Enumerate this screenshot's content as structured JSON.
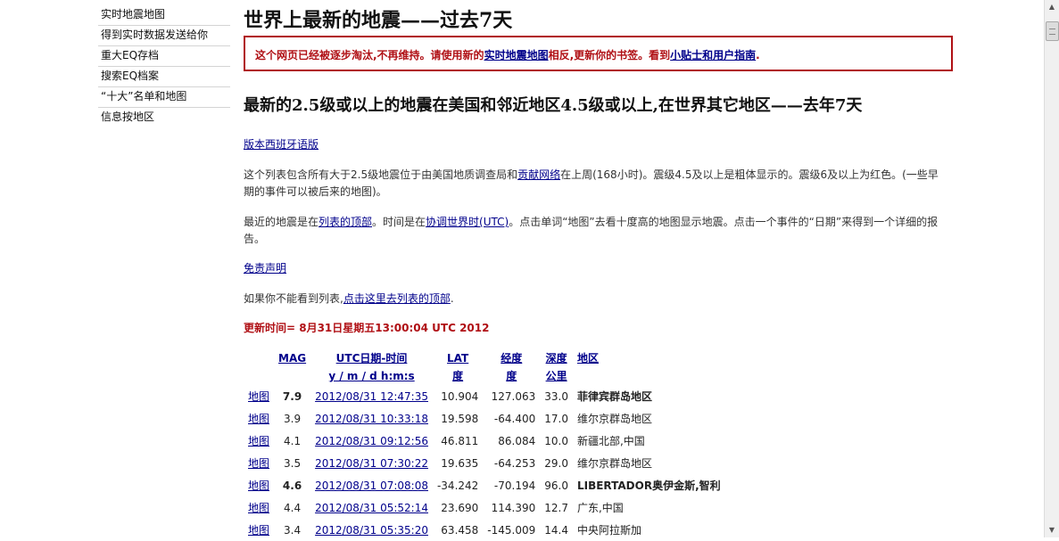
{
  "sidebar": {
    "items": [
      "实时地震地图",
      "得到实时数据发送给你",
      "重大EQ存档",
      "搜索EQ档案",
      "“十大”名单和地图",
      "信息按地区"
    ]
  },
  "header": {
    "title": "世界上最新的地震——过去7天"
  },
  "notice": {
    "text_1": "这个网页已经被逐步淘汰,不再维持。请使用新的",
    "link_1": "实时地震地图",
    "text_2": "相反,更新你的书签。看到",
    "link_2": "小贴士和用户指南",
    "text_3": "."
  },
  "subtitle": "最新的2.5级或以上的地震在美国和邻近地区4.5级或以上,在世界其它地区——去年7天",
  "spanish_link": "版本西班牙语版",
  "description": {
    "text_1": "这个列表包含所有大于2.5级地震位于由美国地质调查局和",
    "link": "贡献网络",
    "text_2": "在上周(168小时)。震级4.5及以上是粗体显示的。震级6及以上为红色。(一些早期的事件可以被后来的地图)。"
  },
  "recent": {
    "text_1": "最近的地震是在",
    "link_1": "列表的顶部",
    "text_2": "。时间是在",
    "link_2": "协调世界时(UTC)",
    "text_3": "。点击单词“地图”去看十度高的地图显示地震。点击一个事件的“日期”来得到一个详细的报告。"
  },
  "disclaimer_link": "免责声明",
  "cannot_see": {
    "text": "如果你不能看到列表,",
    "link": "点击这里去列表的顶部",
    "text_end": "."
  },
  "updated": "更新时间= 8月31日星期五13:00:04 UTC 2012",
  "table": {
    "headers": {
      "mag": "MAG",
      "date_1": "UTC日期-时间",
      "date_2": "y / m / d h:m:s",
      "lat_1": "LAT",
      "lat_2": "度",
      "lon_1": "经度",
      "lon_2": "度",
      "depth_1": "深度",
      "depth_2": "公里",
      "region": "地区"
    },
    "rows": [
      {
        "map": "地图",
        "mag": "7.9",
        "datetime": "2012/08/31 12:47:35",
        "lat": "10.904",
        "lon": "127.063",
        "depth": "33.0",
        "region": "菲律宾群岛地区",
        "style": "red"
      },
      {
        "map": "地图",
        "mag": "3.9",
        "datetime": "2012/08/31 10:33:18",
        "lat": "19.598",
        "lon": "-64.400",
        "depth": "17.0",
        "region": "维尔京群岛地区",
        "style": "normal"
      },
      {
        "map": "地图",
        "mag": "4.1",
        "datetime": "2012/08/31 09:12:56",
        "lat": "46.811",
        "lon": "86.084",
        "depth": "10.0",
        "region": "新疆北部,中国",
        "style": "normal"
      },
      {
        "map": "地图",
        "mag": "3.5",
        "datetime": "2012/08/31 07:30:22",
        "lat": "19.635",
        "lon": "-64.253",
        "depth": "29.0",
        "region": "维尔京群岛地区",
        "style": "normal"
      },
      {
        "map": "地图",
        "mag": "4.6",
        "datetime": "2012/08/31 07:08:08",
        "lat": "-34.242",
        "lon": "-70.194",
        "depth": "96.0",
        "region": "LIBERTADOR奥伊金斯,智利",
        "style": "big"
      },
      {
        "map": "地图",
        "mag": "4.4",
        "datetime": "2012/08/31 05:52:14",
        "lat": "23.690",
        "lon": "114.390",
        "depth": "12.7",
        "region": "广东,中国",
        "style": "normal"
      },
      {
        "map": "地图",
        "mag": "3.4",
        "datetime": "2012/08/31 05:35:20",
        "lat": "63.458",
        "lon": "-145.009",
        "depth": "14.4",
        "region": "中央阿拉斯加",
        "style": "normal"
      }
    ]
  },
  "scrollbar": {
    "up_icon": "scroll-up-arrow-icon",
    "down_icon": "scroll-down-arrow-icon"
  },
  "colors": {
    "accent_red": "#b01015",
    "link_blue": "#00008b"
  }
}
